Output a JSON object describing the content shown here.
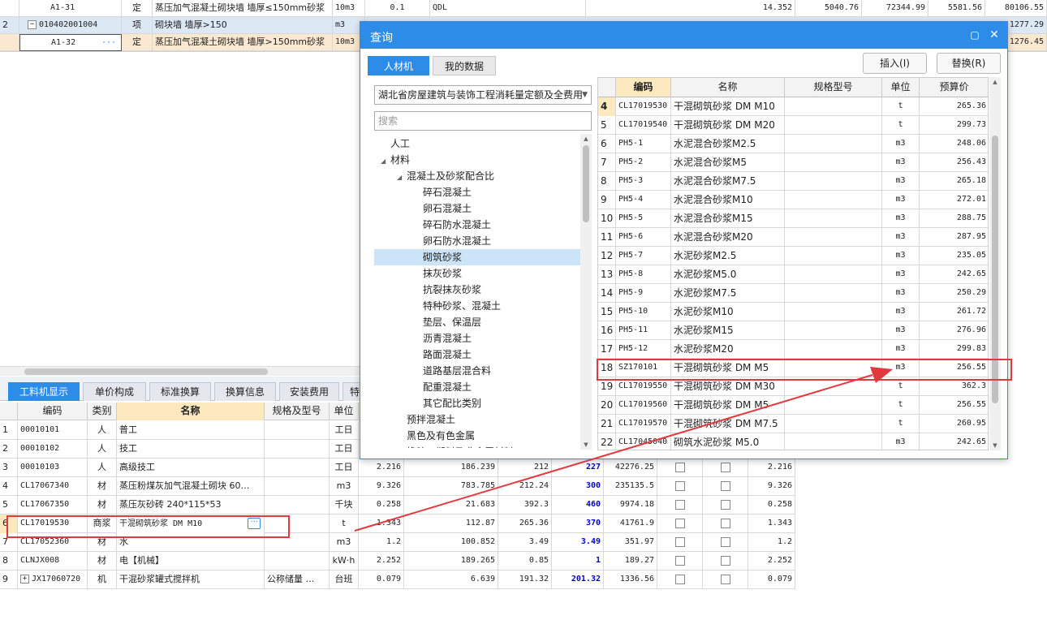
{
  "top_rows": [
    {
      "num": "",
      "code": "A1-31",
      "type": "定",
      "name": "蒸压加气混凝土砌块墙 墙厚≤150mm砂浆",
      "unit": "10m3",
      "qty": "0.1",
      "expr": "QDL",
      "v1": "14.352",
      "v2": "5040.76",
      "v3": "72344.99",
      "v4": "5581.56",
      "v5": "80106.55"
    },
    {
      "num": "2",
      "code": "010402001004",
      "type": "项",
      "name": "砌块墙 墙厚>150",
      "unit": "m3",
      "qty": "",
      "expr": "",
      "v1": "",
      "v2": "",
      "v3": "",
      "v4": "",
      "v5": "1277.29"
    },
    {
      "num": "",
      "code": "A1-32",
      "type": "定",
      "name": "蒸压加气混凝土砌块墙 墙厚>150mm砂浆",
      "unit": "10m3",
      "qty": "",
      "expr": "",
      "v1": "",
      "v2": "",
      "v3": "",
      "v4": "",
      "v5": "1276.45"
    }
  ],
  "bottom_tabs": [
    "工料机显示",
    "单价构成",
    "标准换算",
    "换算信息",
    "安装费用",
    "特"
  ],
  "bottom_headers": {
    "code": "编码",
    "type": "类别",
    "name": "名称",
    "spec": "规格及型号",
    "unit": "单位"
  },
  "bottom_rows": [
    {
      "num": "1",
      "code": "00010101",
      "type": "人",
      "name": "普工",
      "spec": "",
      "unit": "工日",
      "a": "",
      "b": "",
      "c": "",
      "d": "",
      "e": "",
      "f": ""
    },
    {
      "num": "2",
      "code": "00010102",
      "type": "人",
      "name": "技工",
      "spec": "",
      "unit": "工日",
      "a": "",
      "b": "",
      "c": "",
      "d": "",
      "e": "",
      "f": ""
    },
    {
      "num": "3",
      "code": "00010103",
      "type": "人",
      "name": "高级技工",
      "spec": "",
      "unit": "工日",
      "a": "2.216",
      "b": "186.239",
      "c": "212",
      "d": "227",
      "e": "42276.25",
      "f": "2.216"
    },
    {
      "num": "4",
      "code": "CL17067340",
      "type": "材",
      "name": "蒸压粉煤灰加气混凝土砌块 60…",
      "spec": "",
      "unit": "m3",
      "a": "9.326",
      "b": "783.785",
      "c": "212.24",
      "d": "300",
      "e": "235135.5",
      "f": "9.326"
    },
    {
      "num": "5",
      "code": "CL17067350",
      "type": "材",
      "name": "蒸压灰砂砖 240*115*53",
      "spec": "",
      "unit": "千块",
      "a": "0.258",
      "b": "21.683",
      "c": "392.3",
      "d": "460",
      "e": "9974.18",
      "f": "0.258"
    },
    {
      "num": "6",
      "code": "CL17019530",
      "type": "商浆",
      "name": "干混砌筑砂浆 DM M10",
      "spec": "",
      "unit": "t",
      "a": "1.343",
      "b": "112.87",
      "c": "265.36",
      "d": "370",
      "e": "41761.9",
      "f": "1.343"
    },
    {
      "num": "7",
      "code": "CL17052360",
      "type": "材",
      "name": "水",
      "spec": "",
      "unit": "m3",
      "a": "1.2",
      "b": "100.852",
      "c": "3.49",
      "d": "3.49",
      "e": "351.97",
      "f": "1.2"
    },
    {
      "num": "8",
      "code": "CLNJX008",
      "type": "材",
      "name": "电【机械】",
      "spec": "",
      "unit": "kW·h",
      "a": "2.252",
      "b": "189.265",
      "c": "0.85",
      "d": "1",
      "e": "189.27",
      "f": "2.252"
    },
    {
      "num": "9",
      "code": "JX17060720",
      "type": "机",
      "name": "干混砂浆罐式搅拌机",
      "spec": "公称储量 …",
      "unit": "台班",
      "a": "0.079",
      "b": "6.639",
      "c": "191.32",
      "d": "201.32",
      "e": "1336.56",
      "f": "0.079"
    }
  ],
  "dialog": {
    "title": "查询",
    "tab_rcj": "人材机",
    "tab_mydata": "我的数据",
    "insert_label": "插入(I)",
    "replace_label": "替换(R)",
    "library": "湖北省房屋建筑与装饰工程消耗量定额及全费用",
    "search_placeholder": "搜索",
    "tree": [
      {
        "label": "人工",
        "level": 1,
        "tri": ""
      },
      {
        "label": "材料",
        "level": 1,
        "tri": "◢"
      },
      {
        "label": "混凝土及砂浆配合比",
        "level": 2,
        "tri": "◢"
      },
      {
        "label": "碎石混凝土",
        "level": 3,
        "tri": ""
      },
      {
        "label": "卵石混凝土",
        "level": 3,
        "tri": ""
      },
      {
        "label": "碎石防水混凝土",
        "level": 3,
        "tri": ""
      },
      {
        "label": "卵石防水混凝土",
        "level": 3,
        "tri": ""
      },
      {
        "label": "砌筑砂浆",
        "level": 3,
        "tri": ""
      },
      {
        "label": "抹灰砂浆",
        "level": 3,
        "tri": ""
      },
      {
        "label": "抗裂抹灰砂浆",
        "level": 3,
        "tri": ""
      },
      {
        "label": "特种砂浆、混凝土",
        "level": 3,
        "tri": ""
      },
      {
        "label": "垫层、保温层",
        "level": 3,
        "tri": ""
      },
      {
        "label": "沥青混凝土",
        "level": 3,
        "tri": ""
      },
      {
        "label": "路面混凝土",
        "level": 3,
        "tri": ""
      },
      {
        "label": "道路基层混合料",
        "level": 3,
        "tri": ""
      },
      {
        "label": "配重混凝土",
        "level": 3,
        "tri": ""
      },
      {
        "label": "其它配比类别",
        "level": 3,
        "tri": ""
      },
      {
        "label": "预拌混凝土",
        "level": 2,
        "tri": ""
      },
      {
        "label": "黑色及有色金属",
        "level": 2,
        "tri": ""
      },
      {
        "label": "橡胶、塑料及非金属材料",
        "level": 2,
        "tri": ""
      }
    ],
    "headers": {
      "code": "编码",
      "name": "名称",
      "spec": "规格型号",
      "unit": "单位",
      "price": "预算价"
    },
    "rows": [
      {
        "num": "4",
        "code": "CL17019530",
        "name": "干混砌筑砂浆 DM M10",
        "spec": "",
        "unit": "t",
        "price": "265.36"
      },
      {
        "num": "5",
        "code": "CL17019540",
        "name": "干混砌筑砂浆 DM M20",
        "spec": "",
        "unit": "t",
        "price": "299.73"
      },
      {
        "num": "6",
        "code": "PH5-1",
        "name": "水泥混合砂浆M2.5",
        "spec": "",
        "unit": "m3",
        "price": "248.06"
      },
      {
        "num": "7",
        "code": "PH5-2",
        "name": "水泥混合砂浆M5",
        "spec": "",
        "unit": "m3",
        "price": "256.43"
      },
      {
        "num": "8",
        "code": "PH5-3",
        "name": "水泥混合砂浆M7.5",
        "spec": "",
        "unit": "m3",
        "price": "265.18"
      },
      {
        "num": "9",
        "code": "PH5-4",
        "name": "水泥混合砂浆M10",
        "spec": "",
        "unit": "m3",
        "price": "272.01"
      },
      {
        "num": "10",
        "code": "PH5-5",
        "name": "水泥混合砂浆M15",
        "spec": "",
        "unit": "m3",
        "price": "288.75"
      },
      {
        "num": "11",
        "code": "PH5-6",
        "name": "水泥混合砂浆M20",
        "spec": "",
        "unit": "m3",
        "price": "287.95"
      },
      {
        "num": "12",
        "code": "PH5-7",
        "name": "水泥砂浆M2.5",
        "spec": "",
        "unit": "m3",
        "price": "235.05"
      },
      {
        "num": "13",
        "code": "PH5-8",
        "name": "水泥砂浆M5.0",
        "spec": "",
        "unit": "m3",
        "price": "242.65"
      },
      {
        "num": "14",
        "code": "PH5-9",
        "name": "水泥砂浆M7.5",
        "spec": "",
        "unit": "m3",
        "price": "250.29"
      },
      {
        "num": "15",
        "code": "PH5-10",
        "name": "水泥砂浆M10",
        "spec": "",
        "unit": "m3",
        "price": "261.72"
      },
      {
        "num": "16",
        "code": "PH5-11",
        "name": "水泥砂浆M15",
        "spec": "",
        "unit": "m3",
        "price": "276.96"
      },
      {
        "num": "17",
        "code": "PH5-12",
        "name": "水泥砂浆M20",
        "spec": "",
        "unit": "m3",
        "price": "299.83"
      },
      {
        "num": "18",
        "code": "SZ170101",
        "name": "干混砌筑砂浆 DM M5",
        "spec": "",
        "unit": "m3",
        "price": "256.55"
      },
      {
        "num": "19",
        "code": "CL17019550",
        "name": "干混砌筑砂浆 DM M30",
        "spec": "",
        "unit": "t",
        "price": "362.3"
      },
      {
        "num": "20",
        "code": "CL17019560",
        "name": "干混砌筑砂浆 DM M5",
        "spec": "",
        "unit": "t",
        "price": "256.55"
      },
      {
        "num": "21",
        "code": "CL17019570",
        "name": "干混砌筑砂浆 DM M7.5",
        "spec": "",
        "unit": "t",
        "price": "260.95"
      },
      {
        "num": "22",
        "code": "CL17045040",
        "name": "砌筑水泥砂浆 M5.0",
        "spec": "",
        "unit": "m3",
        "price": "242.65"
      }
    ]
  },
  "colors": {
    "accent": "#2d8ce8",
    "highlight": "#e0393e",
    "value_blue": "#0000cc"
  }
}
